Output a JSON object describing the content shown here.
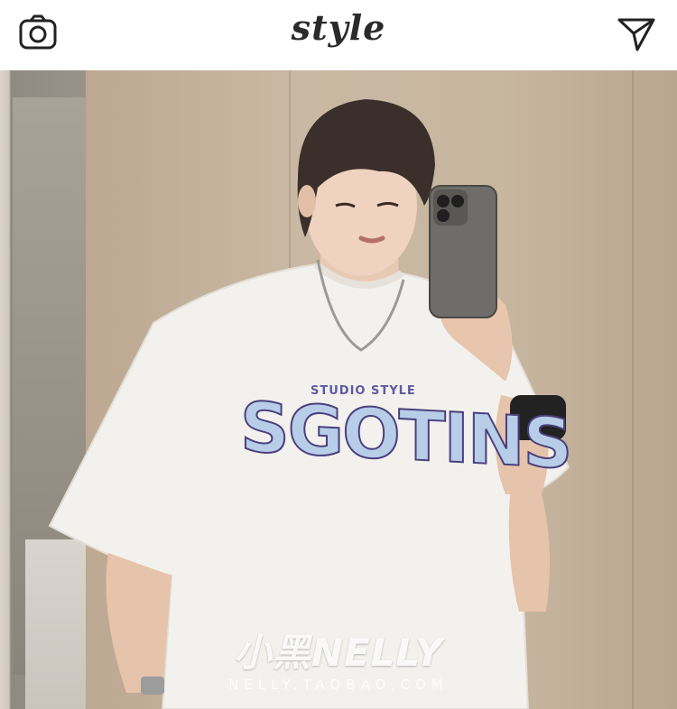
{
  "app": {
    "title": "style"
  },
  "header": {
    "left_icon": "camera-icon",
    "right_icon": "send-icon"
  },
  "post": {
    "shirt_small_text": "STUDIO STYLE",
    "shirt_big_text": "SGOTINS",
    "watermark_main": "小黑NELLY",
    "watermark_sub": "NELLY.TAOBAO.COM"
  },
  "colors": {
    "header_bg": "#ffffff",
    "icon": "#222222",
    "shirt": "#f3f1ed",
    "shirt_lettering": "#b7cde8",
    "shirt_outline": "#4b3f7d"
  }
}
